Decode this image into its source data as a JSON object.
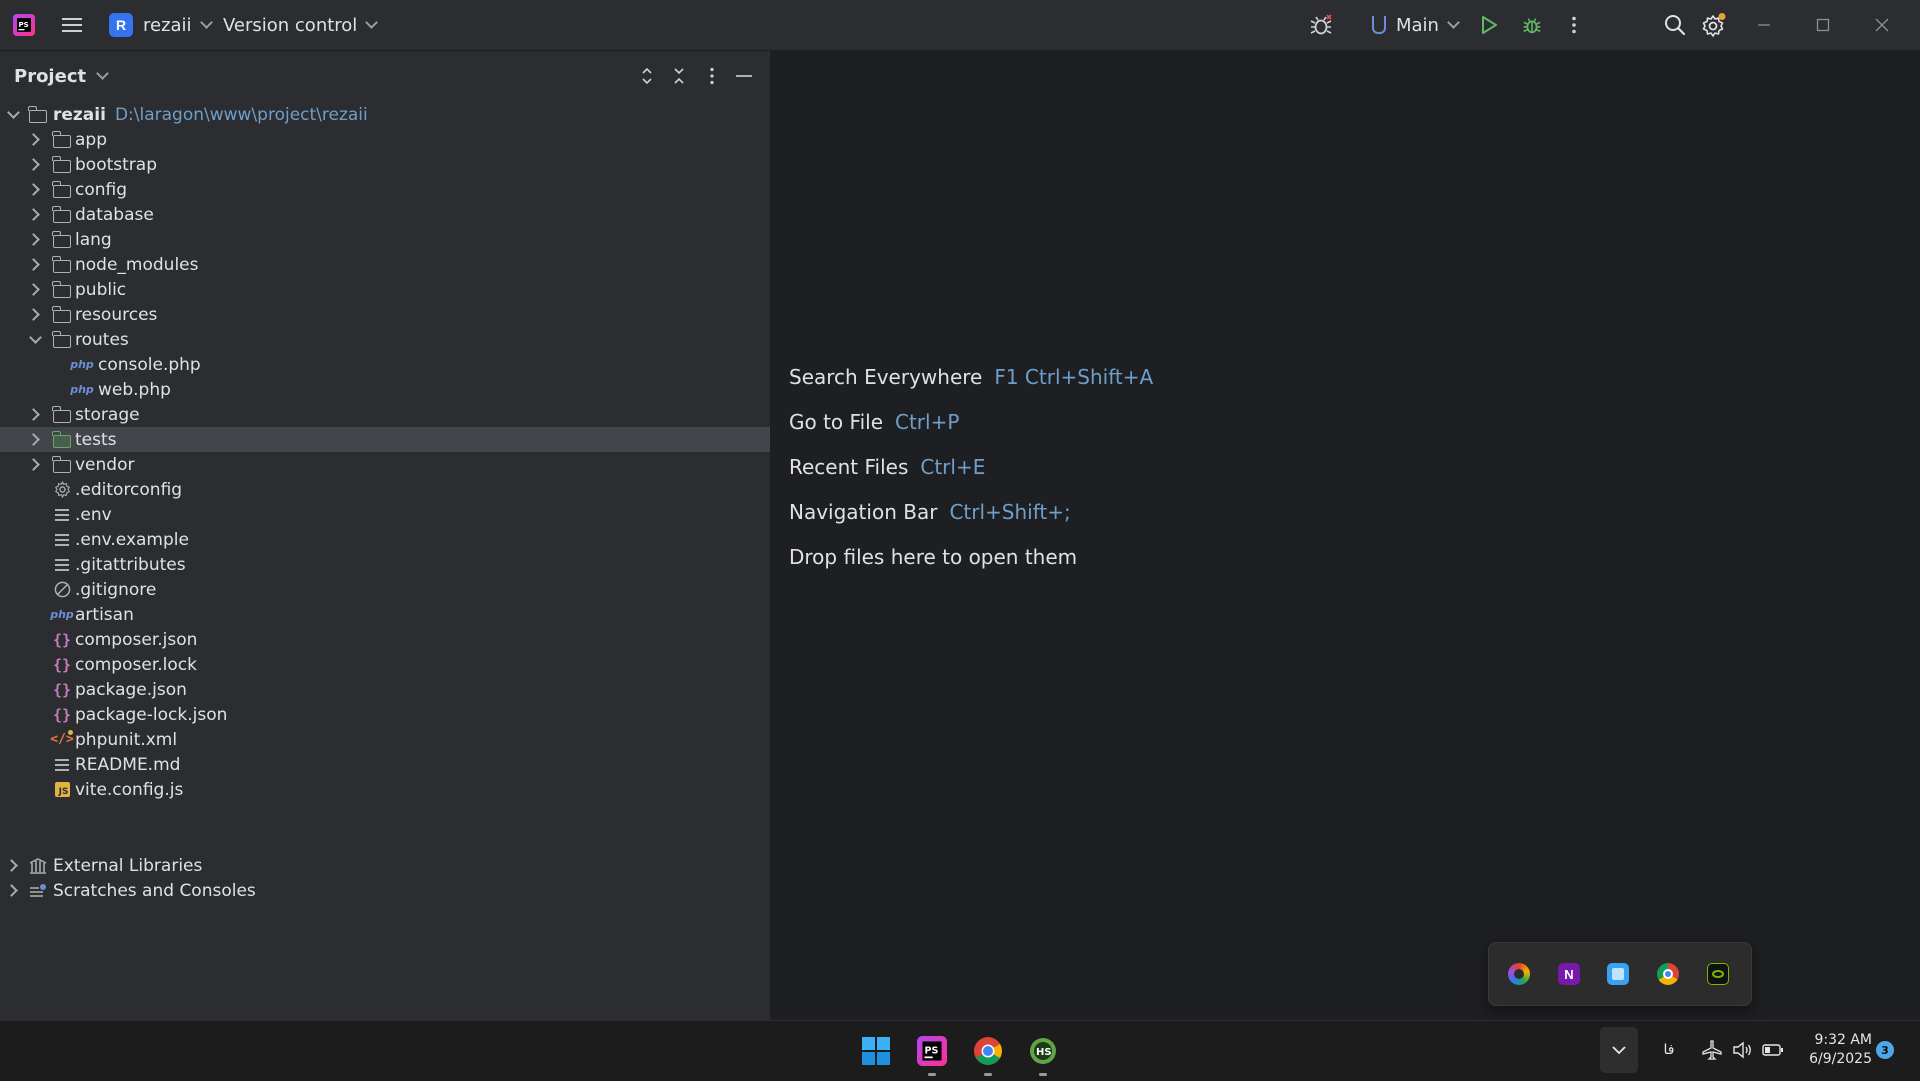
{
  "titlebar": {
    "project_badge": "R",
    "project_name": "rezaii",
    "vcs_label": "Version control",
    "run_config": "Main"
  },
  "project_panel": {
    "title": "Project",
    "root": {
      "name": "rezaii",
      "path": "D:\\laragon\\www\\project\\rezaii"
    },
    "items": [
      {
        "label": "app",
        "icon": "folder-icon",
        "expanded": false
      },
      {
        "label": "bootstrap",
        "icon": "folder-icon",
        "expanded": false
      },
      {
        "label": "config",
        "icon": "folder-icon",
        "expanded": false
      },
      {
        "label": "database",
        "icon": "folder-icon",
        "expanded": false
      },
      {
        "label": "lang",
        "icon": "folder-icon",
        "expanded": false
      },
      {
        "label": "node_modules",
        "icon": "folder-icon",
        "expanded": false
      },
      {
        "label": "public",
        "icon": "folder-icon",
        "expanded": false
      },
      {
        "label": "resources",
        "icon": "folder-icon",
        "expanded": false
      },
      {
        "label": "routes",
        "icon": "folder-icon",
        "expanded": true
      },
      {
        "label": "console.php",
        "icon": "php-file-icon"
      },
      {
        "label": "web.php",
        "icon": "php-file-icon"
      },
      {
        "label": "storage",
        "icon": "folder-icon",
        "expanded": false
      },
      {
        "label": "tests",
        "icon": "test-folder-icon",
        "expanded": false,
        "selected": true
      },
      {
        "label": "vendor",
        "icon": "folder-icon",
        "expanded": false
      },
      {
        "label": ".editorconfig",
        "icon": "settings-file-icon"
      },
      {
        "label": ".env",
        "icon": "text-file-icon"
      },
      {
        "label": ".env.example",
        "icon": "text-file-icon"
      },
      {
        "label": ".gitattributes",
        "icon": "text-file-icon"
      },
      {
        "label": ".gitignore",
        "icon": "ignore-file-icon"
      },
      {
        "label": "artisan",
        "icon": "php-file-icon"
      },
      {
        "label": "composer.json",
        "icon": "json-file-icon"
      },
      {
        "label": "composer.lock",
        "icon": "json-file-icon"
      },
      {
        "label": "package.json",
        "icon": "json-file-icon"
      },
      {
        "label": "package-lock.json",
        "icon": "json-file-icon"
      },
      {
        "label": "phpunit.xml",
        "icon": "xml-file-icon"
      },
      {
        "label": "README.md",
        "icon": "text-file-icon"
      },
      {
        "label": "vite.config.js",
        "icon": "js-file-icon"
      }
    ],
    "external_libraries": "External Libraries",
    "scratches": "Scratches and Consoles"
  },
  "editor_hints": [
    {
      "action": "Search Everywhere",
      "shortcut": "F1 Ctrl+Shift+A"
    },
    {
      "action": "Go to File",
      "shortcut": "Ctrl+P"
    },
    {
      "action": "Recent Files",
      "shortcut": "Ctrl+E"
    },
    {
      "action": "Navigation Bar",
      "shortcut": "Ctrl+Shift+;"
    }
  ],
  "editor_drop_hint": "Drop files here to open them",
  "taskbar": {
    "language": "فا",
    "time": "9:32 AM",
    "date": "6/9/2025",
    "notification_count": "3"
  },
  "colors": {
    "accent": "#3574f0",
    "shortcut_blue": "#6f9fc9",
    "run_green": "#5fb865",
    "panel_bg": "#2b2d30",
    "editor_bg": "#1e1f22",
    "selection_bg": "#43454a"
  }
}
